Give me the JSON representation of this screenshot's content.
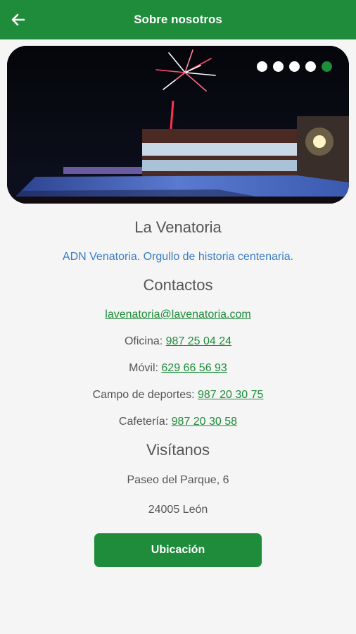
{
  "header": {
    "title": "Sobre nosotros",
    "back_icon": "arrow-left-icon"
  },
  "carousel": {
    "slide_count": 5,
    "active_index": 4
  },
  "about": {
    "title": "La Venatoria",
    "tagline": "ADN Venatoria. Orgullo de historia centenaria."
  },
  "contacts": {
    "title": "Contactos",
    "email": "lavenatoria@lavenatoria.com",
    "office_label": "Oficina:",
    "office_phone": "987 25 04 24",
    "mobile_label": "Móvil:",
    "mobile_phone": "629 66 56 93",
    "sports_label": "Campo de deportes:",
    "sports_phone": "987 20 30 75",
    "cafe_label": "Cafetería:",
    "cafe_phone": "987 20 30 58"
  },
  "visit": {
    "title": "Visítanos",
    "address_line1": "Paseo del Parque, 6",
    "address_line2": "24005 León",
    "button_label": "Ubicación"
  },
  "colors": {
    "primary": "#1e8c3a",
    "tagline": "#3b7dc4"
  }
}
